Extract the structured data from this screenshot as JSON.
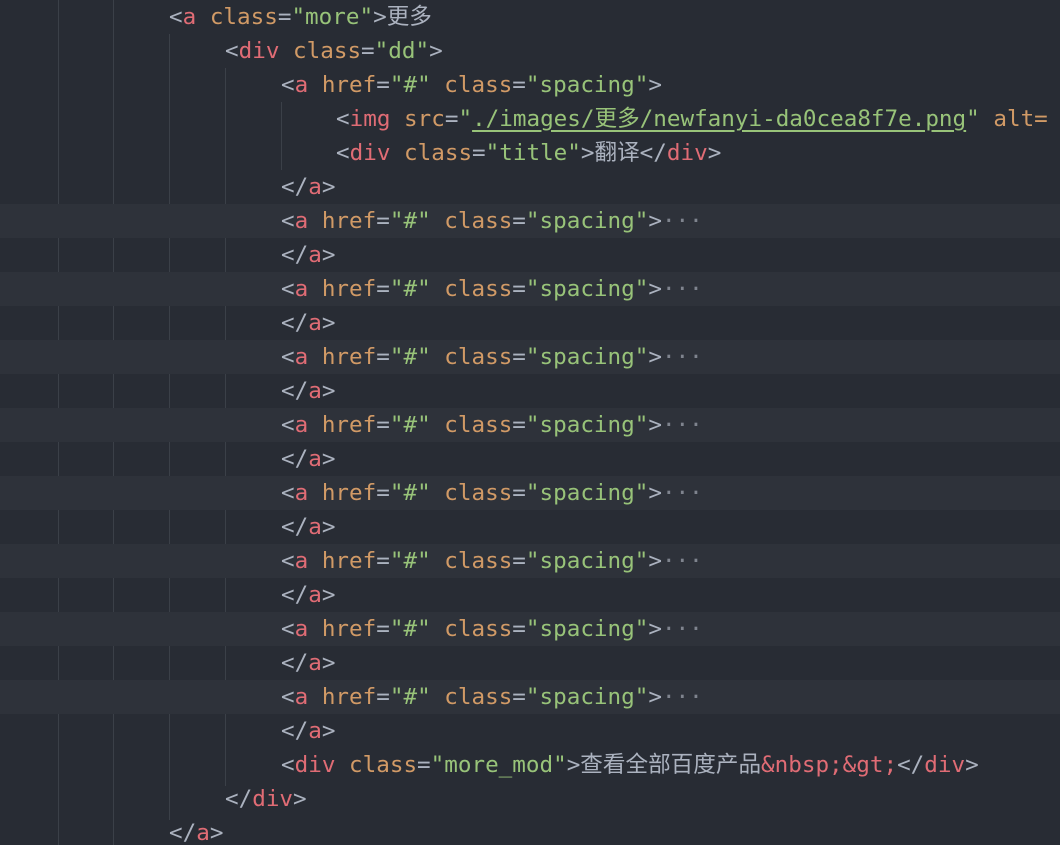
{
  "editor": {
    "lines": [
      {
        "id": "l1",
        "tokens": [
          [
            "br",
            "<"
          ],
          [
            "tag",
            "a"
          ],
          [
            "txt",
            " "
          ],
          [
            "attr",
            "class"
          ],
          [
            "eq",
            "="
          ],
          [
            "str",
            "\"more\""
          ],
          [
            "br",
            ">"
          ],
          [
            "txt",
            "更多"
          ]
        ]
      },
      {
        "id": "l2",
        "tokens": [
          [
            "br",
            "<"
          ],
          [
            "tag",
            "div"
          ],
          [
            "txt",
            " "
          ],
          [
            "attr",
            "class"
          ],
          [
            "eq",
            "="
          ],
          [
            "str",
            "\"dd\""
          ],
          [
            "br",
            ">"
          ]
        ]
      },
      {
        "id": "l3",
        "tokens": [
          [
            "br",
            "<"
          ],
          [
            "tag",
            "a"
          ],
          [
            "txt",
            " "
          ],
          [
            "attr",
            "href"
          ],
          [
            "eq",
            "="
          ],
          [
            "str",
            "\"#\""
          ],
          [
            "txt",
            " "
          ],
          [
            "attr",
            "class"
          ],
          [
            "eq",
            "="
          ],
          [
            "str",
            "\"spacing\""
          ],
          [
            "br",
            ">"
          ]
        ]
      },
      {
        "id": "l4",
        "tokens": [
          [
            "br",
            "<"
          ],
          [
            "tag",
            "img"
          ],
          [
            "txt",
            " "
          ],
          [
            "attr",
            "src"
          ],
          [
            "eq",
            "="
          ],
          [
            "str",
            "\""
          ],
          [
            "link",
            "./images/更多/newfanyi-da0cea8f7e.png"
          ],
          [
            "str",
            "\""
          ],
          [
            "txt",
            " "
          ],
          [
            "attr",
            "alt="
          ]
        ]
      },
      {
        "id": "l5",
        "tokens": [
          [
            "br",
            "<"
          ],
          [
            "tag",
            "div"
          ],
          [
            "txt",
            " "
          ],
          [
            "attr",
            "class"
          ],
          [
            "eq",
            "="
          ],
          [
            "str",
            "\"title\""
          ],
          [
            "br",
            ">"
          ],
          [
            "txt",
            "翻译"
          ],
          [
            "br",
            "</"
          ],
          [
            "tag",
            "div"
          ],
          [
            "br",
            ">"
          ]
        ]
      },
      {
        "id": "l6",
        "tokens": [
          [
            "br",
            "</"
          ],
          [
            "tag",
            "a"
          ],
          [
            "br",
            ">"
          ]
        ]
      },
      {
        "id": "l7",
        "tokens": [
          [
            "br",
            "<"
          ],
          [
            "tag",
            "a"
          ],
          [
            "txt",
            " "
          ],
          [
            "attr",
            "href"
          ],
          [
            "eq",
            "="
          ],
          [
            "str",
            "\"#\""
          ],
          [
            "txt",
            " "
          ],
          [
            "attr",
            "class"
          ],
          [
            "eq",
            "="
          ],
          [
            "str",
            "\"spacing\""
          ],
          [
            "br",
            ">"
          ],
          [
            "fold",
            "···"
          ]
        ]
      },
      {
        "id": "l8",
        "tokens": [
          [
            "br",
            "</"
          ],
          [
            "tag",
            "a"
          ],
          [
            "br",
            ">"
          ]
        ]
      },
      {
        "id": "l9",
        "tokens": [
          [
            "br",
            "<"
          ],
          [
            "tag",
            "a"
          ],
          [
            "txt",
            " "
          ],
          [
            "attr",
            "href"
          ],
          [
            "eq",
            "="
          ],
          [
            "str",
            "\"#\""
          ],
          [
            "txt",
            " "
          ],
          [
            "attr",
            "class"
          ],
          [
            "eq",
            "="
          ],
          [
            "str",
            "\"spacing\""
          ],
          [
            "br",
            ">"
          ],
          [
            "fold",
            "···"
          ]
        ]
      },
      {
        "id": "l10",
        "tokens": [
          [
            "br",
            "</"
          ],
          [
            "tag",
            "a"
          ],
          [
            "br",
            ">"
          ]
        ]
      },
      {
        "id": "l11",
        "tokens": [
          [
            "br",
            "<"
          ],
          [
            "tag",
            "a"
          ],
          [
            "txt",
            " "
          ],
          [
            "attr",
            "href"
          ],
          [
            "eq",
            "="
          ],
          [
            "str",
            "\"#\""
          ],
          [
            "txt",
            " "
          ],
          [
            "attr",
            "class"
          ],
          [
            "eq",
            "="
          ],
          [
            "str",
            "\"spacing\""
          ],
          [
            "br",
            ">"
          ],
          [
            "fold",
            "···"
          ]
        ]
      },
      {
        "id": "l12",
        "tokens": [
          [
            "br",
            "</"
          ],
          [
            "tag",
            "a"
          ],
          [
            "br",
            ">"
          ]
        ]
      },
      {
        "id": "l13",
        "tokens": [
          [
            "br",
            "<"
          ],
          [
            "tag",
            "a"
          ],
          [
            "txt",
            " "
          ],
          [
            "attr",
            "href"
          ],
          [
            "eq",
            "="
          ],
          [
            "str",
            "\"#\""
          ],
          [
            "txt",
            " "
          ],
          [
            "attr",
            "class"
          ],
          [
            "eq",
            "="
          ],
          [
            "str",
            "\"spacing\""
          ],
          [
            "br",
            ">"
          ],
          [
            "fold",
            "···"
          ]
        ]
      },
      {
        "id": "l14",
        "tokens": [
          [
            "br",
            "</"
          ],
          [
            "tag",
            "a"
          ],
          [
            "br",
            ">"
          ]
        ]
      },
      {
        "id": "l15",
        "tokens": [
          [
            "br",
            "<"
          ],
          [
            "tag",
            "a"
          ],
          [
            "txt",
            " "
          ],
          [
            "attr",
            "href"
          ],
          [
            "eq",
            "="
          ],
          [
            "str",
            "\"#\""
          ],
          [
            "txt",
            " "
          ],
          [
            "attr",
            "class"
          ],
          [
            "eq",
            "="
          ],
          [
            "str",
            "\"spacing\""
          ],
          [
            "br",
            ">"
          ],
          [
            "fold",
            "···"
          ]
        ]
      },
      {
        "id": "l16",
        "tokens": [
          [
            "br",
            "</"
          ],
          [
            "tag",
            "a"
          ],
          [
            "br",
            ">"
          ]
        ]
      },
      {
        "id": "l17",
        "tokens": [
          [
            "br",
            "<"
          ],
          [
            "tag",
            "a"
          ],
          [
            "txt",
            " "
          ],
          [
            "attr",
            "href"
          ],
          [
            "eq",
            "="
          ],
          [
            "str",
            "\"#\""
          ],
          [
            "txt",
            " "
          ],
          [
            "attr",
            "class"
          ],
          [
            "eq",
            "="
          ],
          [
            "str",
            "\"spacing\""
          ],
          [
            "br",
            ">"
          ],
          [
            "fold",
            "···"
          ]
        ]
      },
      {
        "id": "l18",
        "tokens": [
          [
            "br",
            "</"
          ],
          [
            "tag",
            "a"
          ],
          [
            "br",
            ">"
          ]
        ]
      },
      {
        "id": "l19",
        "tokens": [
          [
            "br",
            "<"
          ],
          [
            "tag",
            "a"
          ],
          [
            "txt",
            " "
          ],
          [
            "attr",
            "href"
          ],
          [
            "eq",
            "="
          ],
          [
            "str",
            "\"#\""
          ],
          [
            "txt",
            " "
          ],
          [
            "attr",
            "class"
          ],
          [
            "eq",
            "="
          ],
          [
            "str",
            "\"spacing\""
          ],
          [
            "br",
            ">"
          ],
          [
            "fold",
            "···"
          ]
        ]
      },
      {
        "id": "l20",
        "tokens": [
          [
            "br",
            "</"
          ],
          [
            "tag",
            "a"
          ],
          [
            "br",
            ">"
          ]
        ]
      },
      {
        "id": "l21",
        "tokens": [
          [
            "br",
            "<"
          ],
          [
            "tag",
            "a"
          ],
          [
            "txt",
            " "
          ],
          [
            "attr",
            "href"
          ],
          [
            "eq",
            "="
          ],
          [
            "str",
            "\"#\""
          ],
          [
            "txt",
            " "
          ],
          [
            "attr",
            "class"
          ],
          [
            "eq",
            "="
          ],
          [
            "str",
            "\"spacing\""
          ],
          [
            "br",
            ">"
          ],
          [
            "fold",
            "···"
          ]
        ]
      },
      {
        "id": "l22",
        "tokens": [
          [
            "br",
            "</"
          ],
          [
            "tag",
            "a"
          ],
          [
            "br",
            ">"
          ]
        ]
      },
      {
        "id": "l23",
        "tokens": [
          [
            "br",
            "<"
          ],
          [
            "tag",
            "div"
          ],
          [
            "txt",
            " "
          ],
          [
            "attr",
            "class"
          ],
          [
            "eq",
            "="
          ],
          [
            "str",
            "\"more_mod\""
          ],
          [
            "br",
            ">"
          ],
          [
            "txt",
            "查看全部百度产品"
          ],
          [
            "ent",
            "&nbsp;&gt;"
          ],
          [
            "br",
            "</"
          ],
          [
            "tag",
            "div"
          ],
          [
            "br",
            ">"
          ]
        ]
      },
      {
        "id": "l24",
        "tokens": [
          [
            "br",
            "</"
          ],
          [
            "tag",
            "div"
          ],
          [
            "br",
            ">"
          ]
        ]
      },
      {
        "id": "l25",
        "tokens": [
          [
            "br",
            "</"
          ],
          [
            "tag",
            "a"
          ],
          [
            "br",
            ">"
          ]
        ]
      }
    ],
    "folded_placeholder": "···"
  },
  "theme": {
    "background": "#282c34",
    "tag": "#e06c75",
    "attribute": "#d19a66",
    "string": "#98c379",
    "text": "#abb2bf"
  }
}
